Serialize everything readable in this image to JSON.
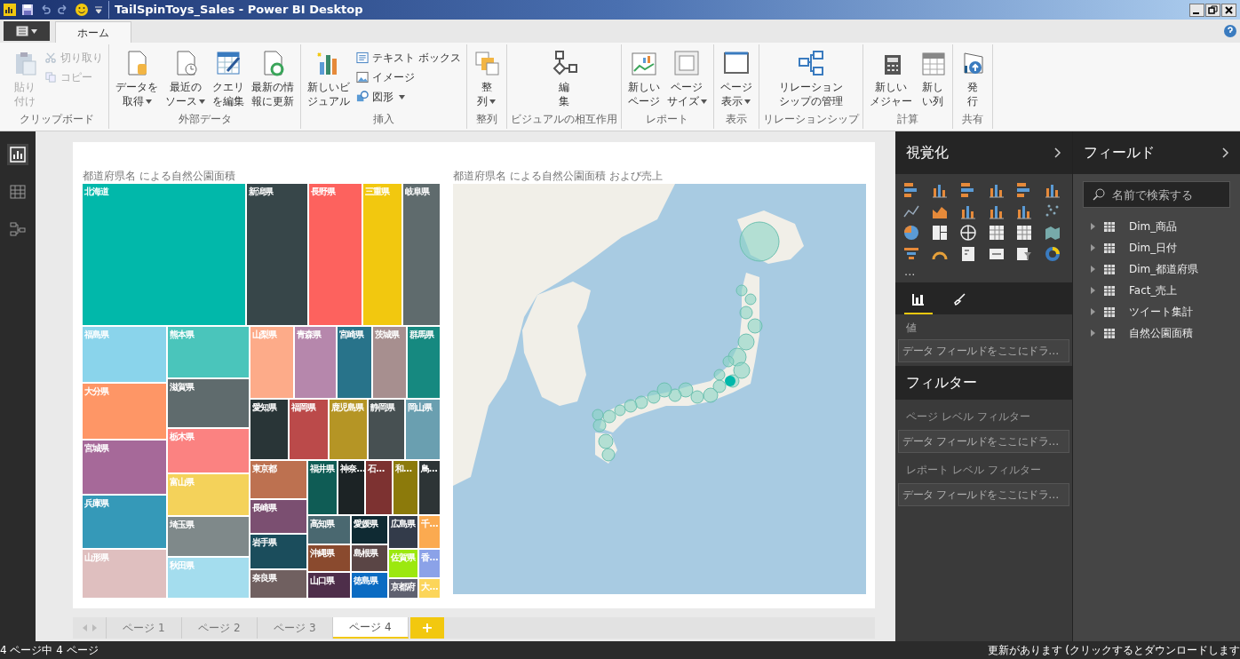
{
  "window": {
    "title": "TailSpinToys_Sales - Power BI Desktop"
  },
  "ribbon_tabs": [
    {
      "label": "ホーム",
      "selected": true
    }
  ],
  "ribbon": {
    "groups": [
      {
        "label": "クリップボード",
        "buttons": [
          {
            "kind": "large",
            "label": "貼り付け",
            "disabled": true,
            "dropdown": false
          },
          {
            "kind": "small",
            "label": "切り取り",
            "disabled": true,
            "dropdown": false
          },
          {
            "kind": "small",
            "label": "コピー",
            "disabled": true,
            "dropdown": false
          }
        ]
      },
      {
        "label": "外部データ",
        "buttons": [
          {
            "kind": "large",
            "label": "データを取得",
            "disabled": false,
            "dropdown": true
          },
          {
            "kind": "large",
            "label": "最近のソース",
            "disabled": false,
            "dropdown": true
          },
          {
            "kind": "large",
            "label": "クエリを編集",
            "disabled": false,
            "dropdown": false
          },
          {
            "kind": "large",
            "label": "最新の情報に更新",
            "disabled": false,
            "dropdown": false
          }
        ]
      },
      {
        "label": "挿入",
        "buttons": [
          {
            "kind": "large",
            "label": "新しいビジュアル",
            "disabled": false,
            "dropdown": false
          },
          {
            "kind": "small",
            "label": "テキスト ボックス",
            "disabled": false,
            "dropdown": false
          },
          {
            "kind": "small",
            "label": "イメージ",
            "disabled": false,
            "dropdown": false
          },
          {
            "kind": "small",
            "label": "図形",
            "disabled": false,
            "dropdown": true
          }
        ]
      },
      {
        "label": "整列",
        "buttons": [
          {
            "kind": "large",
            "label": "整列",
            "disabled": false,
            "dropdown": true
          }
        ]
      },
      {
        "label": "ビジュアルの相互作用",
        "buttons": [
          {
            "kind": "large",
            "label": "編集",
            "disabled": false,
            "dropdown": false
          }
        ]
      },
      {
        "label": "レポート",
        "buttons": [
          {
            "kind": "large",
            "label": "新しいページ",
            "disabled": false,
            "dropdown": false
          },
          {
            "kind": "large",
            "label": "ページサイズ",
            "disabled": false,
            "dropdown": true
          }
        ]
      },
      {
        "label": "表示",
        "buttons": [
          {
            "kind": "large",
            "label": "ページ表示",
            "disabled": false,
            "dropdown": true
          }
        ]
      },
      {
        "label": "リレーションシップ",
        "buttons": [
          {
            "kind": "large",
            "label": "リレーションシップの管理",
            "disabled": false,
            "dropdown": false
          }
        ]
      },
      {
        "label": "計算",
        "buttons": [
          {
            "kind": "large",
            "label": "新しいメジャー",
            "disabled": false,
            "dropdown": false
          },
          {
            "kind": "large",
            "label": "新しい列",
            "disabled": false,
            "dropdown": false
          }
        ]
      },
      {
        "label": "共有",
        "buttons": [
          {
            "kind": "large",
            "label": "発行",
            "disabled": false,
            "dropdown": false
          }
        ]
      }
    ]
  },
  "nav": [
    {
      "selected": true
    },
    {
      "selected": false
    },
    {
      "selected": false
    }
  ],
  "treemap": {
    "title": "都道府県名 による自然公園面積",
    "tiles": [
      {
        "label": "北海道",
        "color": "#01b8aa"
      },
      {
        "label": "新潟県",
        "color": "#374649"
      },
      {
        "label": "長野県",
        "color": "#fd625e"
      },
      {
        "label": "三重県",
        "color": "#f2c80f"
      },
      {
        "label": "岐阜県",
        "color": "#5f6b6d"
      },
      {
        "label": "福島県",
        "color": "#8ad4eb"
      },
      {
        "label": "大分県",
        "color": "#fe9666"
      },
      {
        "label": "宮城県",
        "color": "#a66999"
      },
      {
        "label": "兵庫県",
        "color": "#3599b8"
      },
      {
        "label": "山形県",
        "color": "#dfbfbf"
      },
      {
        "label": "熊本県",
        "color": "#4ac5bb"
      },
      {
        "label": "滋賀県",
        "color": "#5f6b6d"
      },
      {
        "label": "栃木県",
        "color": "#fb8281"
      },
      {
        "label": "富山県",
        "color": "#f4d25a"
      },
      {
        "label": "埼玉県",
        "color": "#7f898a"
      },
      {
        "label": "秋田県",
        "color": "#a4ddee"
      },
      {
        "label": "山梨県",
        "color": "#fdab89"
      },
      {
        "label": "青森県",
        "color": "#b687ac"
      },
      {
        "label": "宮崎県",
        "color": "#28738a"
      },
      {
        "label": "茨城県",
        "color": "#a78f8f"
      },
      {
        "label": "群馬県",
        "color": "#168980"
      },
      {
        "label": "愛知県",
        "color": "#293537"
      },
      {
        "label": "福岡県",
        "color": "#bb4a4a"
      },
      {
        "label": "鹿児島県",
        "color": "#b59525"
      },
      {
        "label": "静岡県",
        "color": "#475052"
      },
      {
        "label": "岡山県",
        "color": "#6a9fb0"
      },
      {
        "label": "東京都",
        "color": "#bd7150"
      },
      {
        "label": "長崎県",
        "color": "#7b4f71"
      },
      {
        "label": "岩手県",
        "color": "#1b4d5c"
      },
      {
        "label": "奈良県",
        "color": "#706060"
      },
      {
        "label": "福井県",
        "color": "#0f5c55"
      },
      {
        "label": "神奈…",
        "color": "#1c2325"
      },
      {
        "label": "石…",
        "color": "#7d3231"
      },
      {
        "label": "和…",
        "color": "#8c7a0b"
      },
      {
        "label": "鳥…",
        "color": "#2d3436"
      },
      {
        "label": "高知県",
        "color": "#4a6870"
      },
      {
        "label": "沖縄県",
        "color": "#8a4a2e"
      },
      {
        "label": "山口県",
        "color": "#4e2e4a"
      },
      {
        "label": "愛媛県",
        "color": "#0f2a33"
      },
      {
        "label": "島根県",
        "color": "#5a4545"
      },
      {
        "label": "徳島県",
        "color": "#0b6bc2"
      },
      {
        "label": "広島県",
        "color": "#333b4a"
      },
      {
        "label": "佐賀県",
        "color": "#9ce80f"
      },
      {
        "label": "京都府",
        "color": "#5f6170"
      },
      {
        "label": "千…",
        "color": "#fbaa50"
      },
      {
        "label": "香…",
        "color": "#8ba2e8"
      },
      {
        "label": "大…",
        "color": "#fcd55a"
      }
    ]
  },
  "map": {
    "title": "都道府県名 による自然公園面積 および売上"
  },
  "page_tabs": [
    {
      "label": "ページ 1",
      "selected": false
    },
    {
      "label": "ページ 2",
      "selected": false
    },
    {
      "label": "ページ 3",
      "selected": false
    },
    {
      "label": "ページ 4",
      "selected": true
    }
  ],
  "add_page": "+",
  "visualizations": {
    "title": "視覚化",
    "more": "...",
    "tabs": [
      {
        "selected": true
      },
      {
        "selected": false
      }
    ],
    "values_label": "値",
    "values_well": "データ フィールドをここにドラ…"
  },
  "filters": {
    "title": "フィルター",
    "sections": [
      {
        "label": "ページ レベル フィルター",
        "well": "データ フィールドをここにドラ…"
      },
      {
        "label": "レポート レベル フィルター",
        "well": "データ フィールドをここにドラ…"
      }
    ]
  },
  "fields": {
    "title": "フィールド",
    "search": {
      "placeholder": "名前で検索する"
    },
    "tables": [
      {
        "name": "Dim_商品",
        "expanded": false
      },
      {
        "name": "Dim_日付",
        "expanded": false
      },
      {
        "name": "Dim_都道府県",
        "expanded": false
      },
      {
        "name": "Fact_売上",
        "expanded": false
      },
      {
        "name": "ツイート集計",
        "expanded": false
      },
      {
        "name": "自然公園面積",
        "expanded": false
      }
    ]
  },
  "status_bar": {
    "page_info": "4 ページ中 4 ページ",
    "update": "更新があります (クリックするとダウンロードします"
  }
}
